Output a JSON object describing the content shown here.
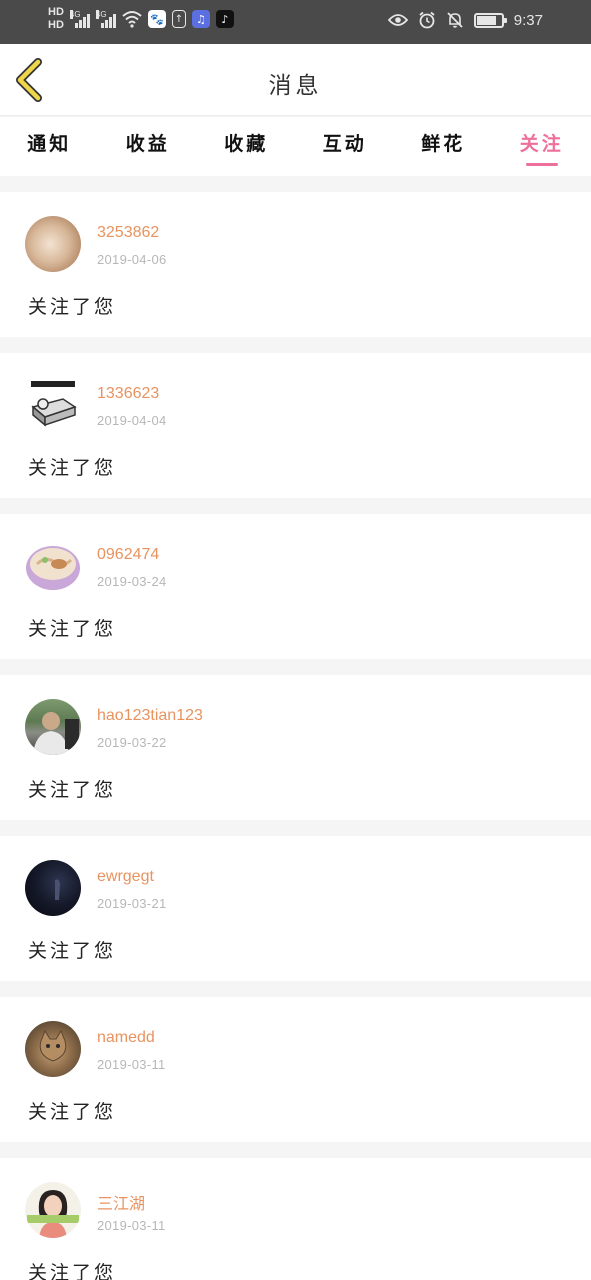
{
  "status_bar": {
    "hd1": "HD",
    "hd2": "HD",
    "net1": "4G",
    "net2": "4G",
    "time": "9:37",
    "battery_level": 0.8
  },
  "header": {
    "title": "消息"
  },
  "tabs": [
    {
      "label": "通知",
      "active": false
    },
    {
      "label": "收益",
      "active": false
    },
    {
      "label": "收藏",
      "active": false
    },
    {
      "label": "互动",
      "active": false
    },
    {
      "label": "鲜花",
      "active": false
    },
    {
      "label": "关注",
      "active": true
    }
  ],
  "messages": [
    {
      "username": "3253862",
      "date": "2019-04-06",
      "text": "关注了您",
      "avatar": "avatar-beige-photo"
    },
    {
      "username": "1336623",
      "date": "2019-04-04",
      "text": "关注了您",
      "avatar": "avatar-bed-sticker"
    },
    {
      "username": "0962474",
      "date": "2019-03-24",
      "text": "关注了您",
      "avatar": "avatar-noodle-bowl"
    },
    {
      "username": "hao123tian123",
      "date": "2019-03-22",
      "text": "关注了您",
      "avatar": "avatar-man-photo"
    },
    {
      "username": "ewrgegt",
      "date": "2019-03-21",
      "text": "关注了您",
      "avatar": "avatar-dark-night"
    },
    {
      "username": "namedd",
      "date": "2019-03-11",
      "text": "关注了您",
      "avatar": "avatar-cat"
    },
    {
      "username": "三江湖",
      "date": "2019-03-11",
      "text": "关注了您",
      "avatar": "avatar-woman"
    }
  ],
  "colors": {
    "accent": "#ee6f9b",
    "username": "#e8935f",
    "date": "#b7b7b7",
    "back_arrow": "#f0d64a"
  }
}
